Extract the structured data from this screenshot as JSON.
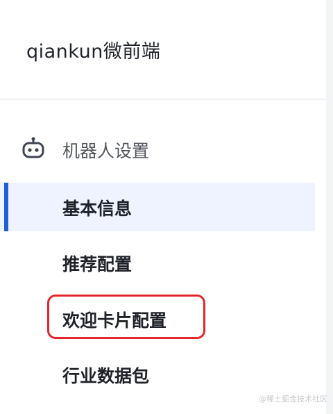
{
  "app": {
    "title": "qiankun微前端"
  },
  "menu": {
    "group": {
      "label": "机器人设置",
      "icon": "robot-icon"
    },
    "items": [
      {
        "label": "基本信息",
        "active": true
      },
      {
        "label": "推荐配置",
        "active": false
      },
      {
        "label": "欢迎卡片配置",
        "active": false,
        "highlighted": true
      },
      {
        "label": "行业数据包",
        "active": false
      }
    ]
  },
  "watermark": "@稀土掘金技术社区",
  "colors": {
    "accent": "#1f5fd6",
    "active_bg": "#eef3ff",
    "highlight_border": "#e4262b"
  }
}
